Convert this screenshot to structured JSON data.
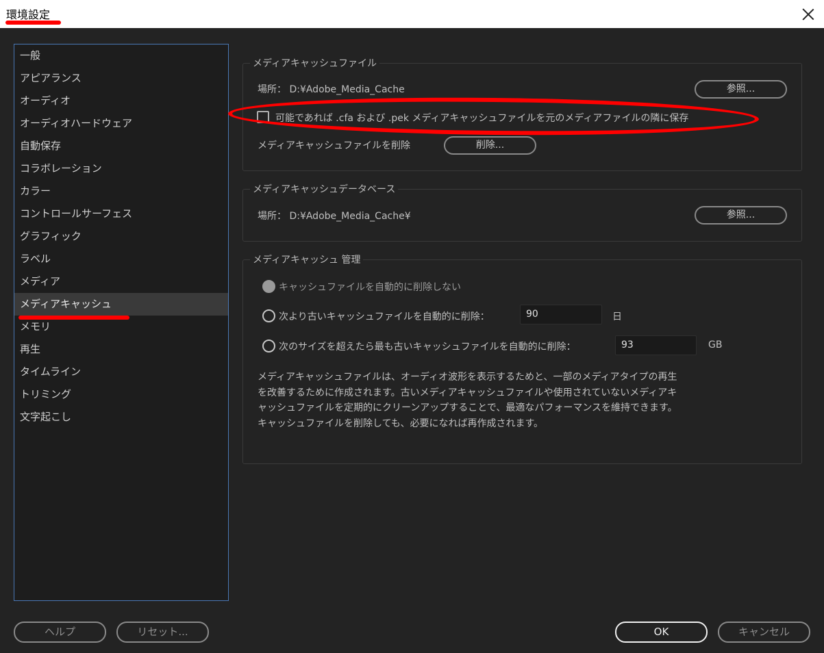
{
  "window": {
    "title": "環境設定"
  },
  "sidebar": {
    "items": [
      {
        "label": "一般"
      },
      {
        "label": "アピアランス"
      },
      {
        "label": "オーディオ"
      },
      {
        "label": "オーディオハードウェア"
      },
      {
        "label": "自動保存"
      },
      {
        "label": "コラボレーション"
      },
      {
        "label": "カラー"
      },
      {
        "label": "コントロールサーフェス"
      },
      {
        "label": "グラフィック"
      },
      {
        "label": "ラベル"
      },
      {
        "label": "メディア"
      },
      {
        "label": "メディアキャッシュ",
        "selected": true
      },
      {
        "label": "メモリ"
      },
      {
        "label": "再生"
      },
      {
        "label": "タイムライン"
      },
      {
        "label": "トリミング"
      },
      {
        "label": "文字起こし"
      }
    ]
  },
  "cache_files": {
    "heading": "メディアキャッシュファイル",
    "location": "場所： D:¥Adobe_Media_Cache",
    "browse_label": "参照...",
    "checkbox_label": "可能であれば .cfa および .pek メディアキャッシュファイルを元のメディアファイルの隣に保存",
    "checkbox_checked": false,
    "delete_text": "メディアキャッシュファイルを削除",
    "delete_label": "削除..."
  },
  "cache_db": {
    "heading": "メディアキャッシュデータベース",
    "location": "場所： D:¥Adobe_Media_Cache¥",
    "browse_label": "参照..."
  },
  "cache_mgmt": {
    "heading": "メディアキャッシュ 管理",
    "option_none": "キャッシュファイルを自動的に削除しない",
    "option_older": "次より古いキャッシュファイルを自動的に削除：",
    "older_value": "90",
    "older_unit": "日",
    "option_size": "次のサイズを超えたら最も古いキャッシュファイルを自動的に削除：",
    "size_value": "93",
    "size_unit": "GB",
    "description": "メディアキャッシュファイルは、オーディオ波形を表示するためと、一部のメディアタイプの再生を改善するために作成されます。古いメディアキャッシュファイルや使用されていないメディアキャッシュファイルを定期的にクリーンアップすることで、最適なパフォーマンスを維持できます。キャッシュファイルを削除しても、必要になれば再作成されます。"
  },
  "footer": {
    "help_label": "ヘルプ",
    "reset_label": "リセット...",
    "ok_label": "OK",
    "cancel_label": "キャンセル"
  },
  "colors": {
    "background": "#232323",
    "sidebar_border": "#4a78b5",
    "annotation": "#ff0000"
  }
}
